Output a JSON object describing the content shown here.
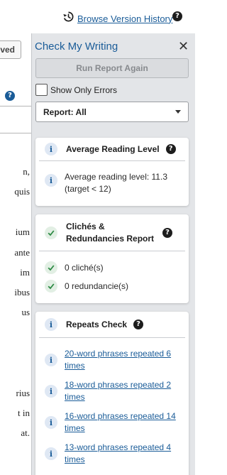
{
  "topbar": {
    "history_link": "Browse Version History"
  },
  "editor": {
    "saved_label": "ved",
    "fragments": [
      "n,",
      "quis",
      "ium",
      "ante",
      "im",
      "ibus",
      "us",
      "rius",
      "t in",
      "at."
    ]
  },
  "panel": {
    "title": "Check My Writing",
    "run_button": "Run Report Again",
    "only_errors_label": "Show Only Errors",
    "report_select": "Report: All",
    "cards": {
      "reading": {
        "title": "Average Reading Level",
        "items": [
          {
            "text": "Average reading level: 11.3 (target < 12)"
          }
        ]
      },
      "cliches": {
        "title": "Clichés & Redundancies Report",
        "items": [
          {
            "text": "0 cliché(s)"
          },
          {
            "text": "0 redundancie(s)"
          }
        ]
      },
      "repeats": {
        "title": "Repeats Check",
        "items": [
          {
            "text": "20-word phrases repeated 6 times"
          },
          {
            "text": "18-word phrases repeated 2 times"
          },
          {
            "text": "16-word phrases repeated 14 times"
          },
          {
            "text": "13-word phrases repeated 4 times"
          }
        ]
      }
    }
  },
  "colors": {
    "accent": "#1a5c98",
    "panel_bg": "#e3e5e8",
    "success": "#2e8b45"
  },
  "icons": [
    "history-icon",
    "help-icon",
    "close-icon",
    "info-icon",
    "check-circle-icon",
    "chevron-down-icon"
  ]
}
